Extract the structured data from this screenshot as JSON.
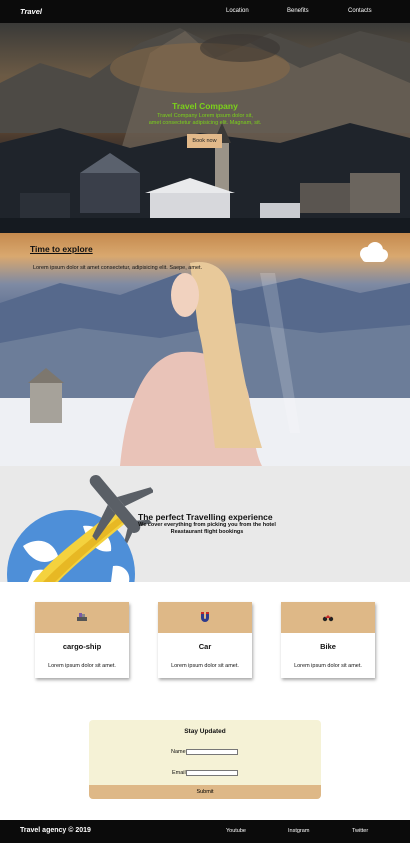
{
  "nav": {
    "brand": "Travel",
    "links": [
      "Location",
      "Benefits",
      "Contacts"
    ]
  },
  "hero": {
    "title": "Travel Company",
    "subtitle_line1": "Travel Company Lorem ipsum dolor sit,",
    "subtitle_line2": "amet consectetur adipisicing elit. Magnam, sit.",
    "button": "Book now"
  },
  "explore": {
    "heading": "Time to explore",
    "text": "Lorem ipsum dolor sit amet consectetur, adipisicing elit. Saepe, amet."
  },
  "perfect": {
    "heading": "The perfect Travelling experience",
    "text": "We cover everything from picking you from the hotel Reastaurant flight bookings"
  },
  "cards": [
    {
      "title": "cargo-ship",
      "text": "Lorem ipsum dolor sit amet.",
      "icon": "cargo-ship-icon"
    },
    {
      "title": "Car",
      "text": "Lorem ipsum dolor sit amet.",
      "icon": "magnet-icon"
    },
    {
      "title": "Bike",
      "text": "Lorem ipsum dolor sit amet.",
      "icon": "motorbike-icon"
    }
  ],
  "form": {
    "heading": "Stay Updated",
    "name_label": "Name",
    "email_label": "Email",
    "submit": "Submit"
  },
  "footer": {
    "brand": "Travel agency © 2019",
    "links": [
      "Youtube",
      "Instgram",
      "Twitter"
    ]
  },
  "colors": {
    "accent_green": "#7bd21a",
    "tan": "#deb887",
    "cream": "#f5f2d6",
    "dark": "#0b0b0b"
  }
}
